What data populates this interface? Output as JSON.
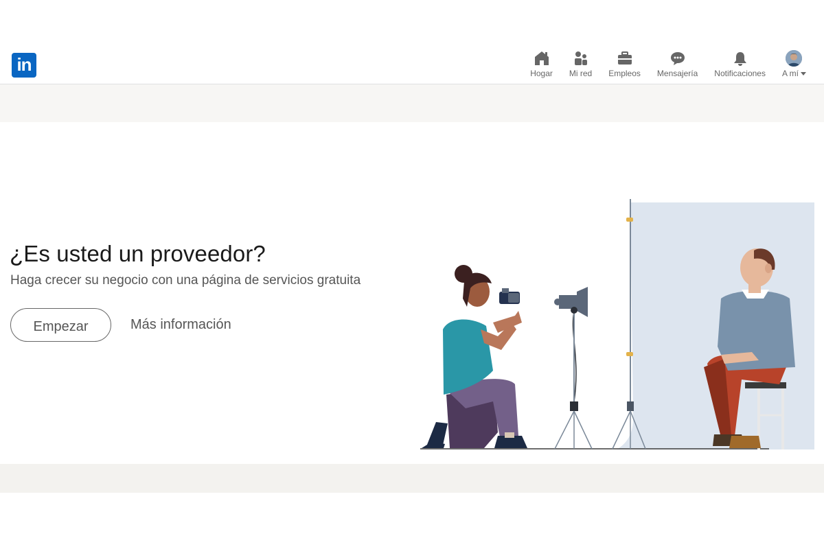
{
  "nav": {
    "logo_text": "in",
    "items": [
      {
        "label": "Hogar",
        "icon": "home-icon"
      },
      {
        "label": "Mi red",
        "icon": "network-icon"
      },
      {
        "label": "Empleos",
        "icon": "briefcase-icon"
      },
      {
        "label": "Mensajería",
        "icon": "messaging-icon"
      },
      {
        "label": "Notificaciones",
        "icon": "bell-icon"
      },
      {
        "label": "A mí",
        "icon": "avatar"
      }
    ]
  },
  "hero": {
    "title": "¿Es usted un proveedor?",
    "subtitle": "Haga crecer su negocio con una página de servicios gratuita",
    "primary_button": "Empezar",
    "secondary_link": "Más información"
  },
  "colors": {
    "brand": "#0a66c2",
    "nav_icon": "#666666",
    "band": "#f3f2ef",
    "backdrop": "#dde5ef"
  }
}
